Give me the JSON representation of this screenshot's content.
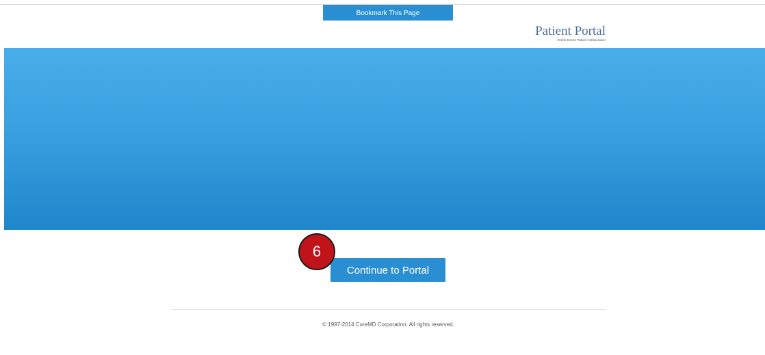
{
  "header": {
    "bookmark_label": "Bookmark This Page",
    "logo": {
      "title": "Patient Portal",
      "tagline": "Online Doctor Patient Collaboration"
    }
  },
  "main": {
    "continue_label": "Continue to Portal",
    "step_marker": "6"
  },
  "footer": {
    "copyright": "© 1997-2014 CureMD Corporation. All rights reserved."
  },
  "colors": {
    "accent": "#2a8fd2",
    "banner_top": "#48ade8",
    "banner_bottom": "#1f86cc",
    "marker": "#c0141a"
  }
}
